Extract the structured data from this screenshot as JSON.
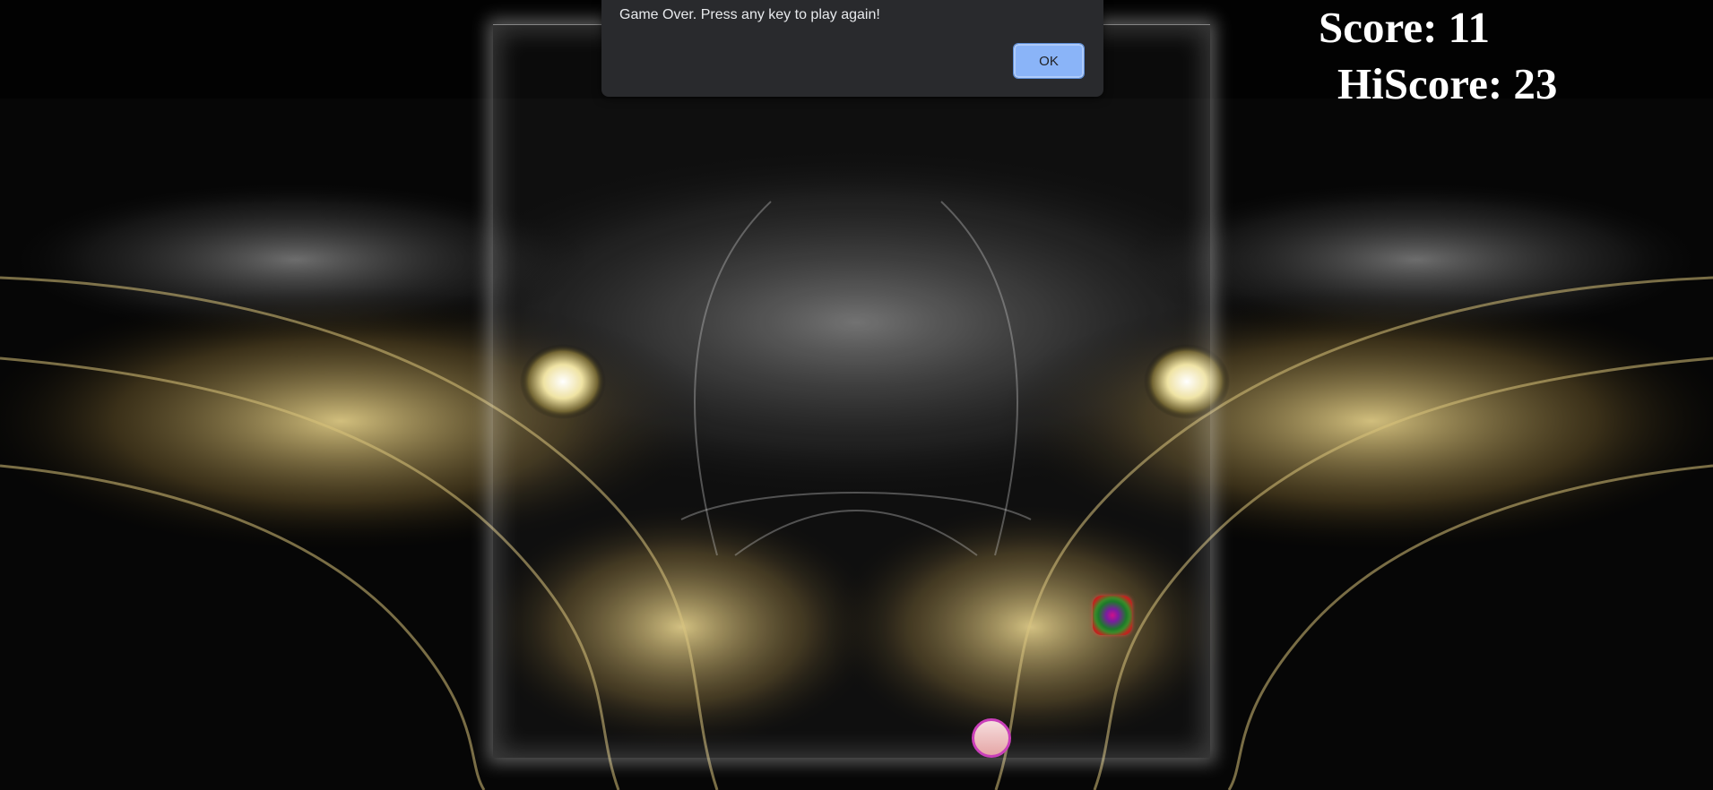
{
  "game": {
    "score_text": "Score: 11",
    "hiscore_text": "HiScore: 23"
  },
  "alert_dialog": {
    "message": "Game Over. Press any key to play again!",
    "ok_label": "OK"
  },
  "colors": {
    "hud_text": "#ffffff",
    "dialog_bg": "#292a2d",
    "ok_button": "#8ab4f8",
    "player_border": "#c93fb9",
    "target_outer": "#b31c1c"
  }
}
